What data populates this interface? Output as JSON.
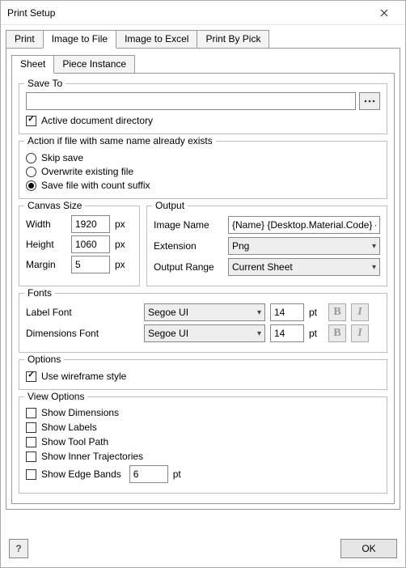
{
  "window": {
    "title": "Print Setup"
  },
  "tabs_outer": {
    "print": "Print",
    "itf": "Image to File",
    "ite": "Image to Excel",
    "pbp": "Print By Pick"
  },
  "tabs_inner": {
    "sheet": "Sheet",
    "piece": "Piece Instance"
  },
  "save_to": {
    "legend": "Save To",
    "path": "",
    "active_dir": "Active document directory"
  },
  "action": {
    "legend": "Action if file with same name already exists",
    "skip": "Skip save",
    "overwrite": "Overwrite existing file",
    "countsuffix": "Save file with count suffix"
  },
  "canvas": {
    "legend": "Canvas Size",
    "width_label": "Width",
    "width": "1920",
    "height_label": "Height",
    "height": "1060",
    "margin_label": "Margin",
    "margin": "5",
    "unit": "px"
  },
  "output": {
    "legend": "Output",
    "imgname_label": "Image Name",
    "imgname": "{Name} {Desktop.Material.Code} {Desktop",
    "ext_label": "Extension",
    "ext": "Png",
    "range_label": "Output Range",
    "range": "Current Sheet"
  },
  "fonts": {
    "legend": "Fonts",
    "label_font_label": "Label Font",
    "label_font": "Segoe UI",
    "label_size": "14",
    "dim_font_label": "Dimensions Font",
    "dim_font": "Segoe UI",
    "dim_size": "14",
    "unit": "pt",
    "bold": "B",
    "italic": "I"
  },
  "options": {
    "legend": "Options",
    "wireframe": "Use wireframe style"
  },
  "view": {
    "legend": "View Options",
    "dims": "Show Dimensions",
    "labels": "Show Labels",
    "toolpath": "Show Tool Path",
    "inner": "Show Inner Trajectories",
    "edge": "Show Edge Bands",
    "edge_val": "6",
    "edge_unit": "pt"
  },
  "footer": {
    "help": "?",
    "ok": "OK"
  }
}
